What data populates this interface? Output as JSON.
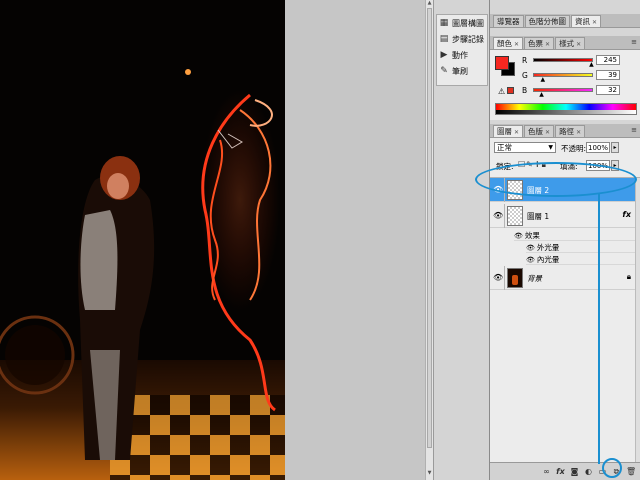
{
  "dock": {
    "items": [
      {
        "icon": "histogram-icon",
        "glyph": "▦",
        "label": "圖層構圖"
      },
      {
        "icon": "history-icon",
        "glyph": "▤",
        "label": "步驟記錄"
      },
      {
        "icon": "actions-icon",
        "glyph": "▶",
        "label": "動作"
      },
      {
        "icon": "brush-icon",
        "glyph": "✎",
        "label": "筆刷"
      }
    ]
  },
  "top_tabs": {
    "tabs": [
      "導覽器",
      "色階分佈圖",
      "資訊"
    ],
    "active_index": 2
  },
  "color_panel": {
    "tabs": [
      "顏色",
      "色票",
      "樣式"
    ],
    "active_index": 0,
    "foreground_color": "#f52720",
    "background_color": "#000000",
    "channels": [
      {
        "name": "R",
        "value": "245",
        "level": 0.96
      },
      {
        "name": "G",
        "value": "39",
        "level": 0.15
      },
      {
        "name": "B",
        "value": "32",
        "level": 0.13
      }
    ]
  },
  "layers_tabs": {
    "tabs": [
      "圖層",
      "色版",
      "路徑"
    ],
    "active_index": 0
  },
  "layers_panel": {
    "blend_mode": "正常",
    "opacity_label": "不透明:",
    "opacity_value": "100%",
    "lock_label": "鎖定:",
    "fill_label": "填滿:",
    "fill_value": "100%",
    "layers": [
      {
        "name": "圖層 2",
        "selected": true,
        "visible": true,
        "thumb": "transparent"
      },
      {
        "name": "圖層 1",
        "selected": false,
        "visible": true,
        "thumb": "transparent",
        "fx": "fx"
      },
      {
        "name": "背景",
        "selected": false,
        "visible": true,
        "thumb": "photo",
        "locked": true
      }
    ],
    "effects": {
      "header": "效果",
      "items": [
        "外光暈",
        "內光暈"
      ]
    },
    "footer_buttons": [
      "link-icon",
      "fx-icon",
      "mask-icon",
      "adjustment-icon",
      "group-folder-icon",
      "new-layer-icon",
      "trash-icon"
    ]
  },
  "colors": {
    "selection": "#3e9bea",
    "annotation": "#1a8fd0"
  }
}
